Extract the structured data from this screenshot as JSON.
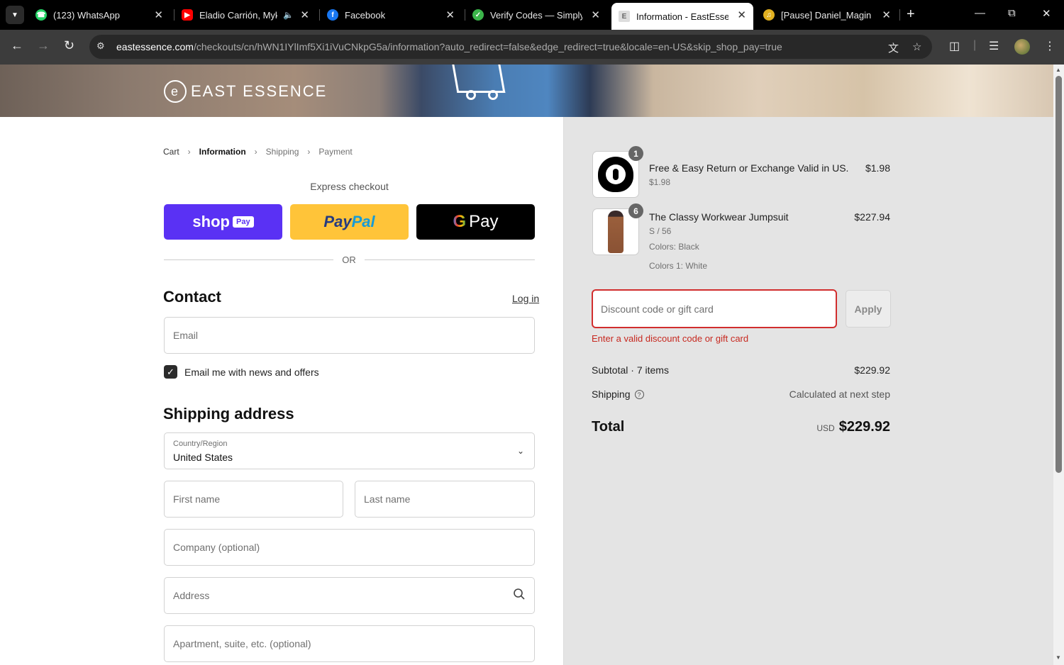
{
  "browser": {
    "tabs": [
      {
        "title": "(123) WhatsApp",
        "icon": "whatsapp-icon",
        "color": "#25d366"
      },
      {
        "title": "Eladio Carrión, Myk",
        "icon": "youtube-icon",
        "color": "#ff0000"
      },
      {
        "title": "Facebook",
        "icon": "facebook-icon",
        "color": "#1877f2"
      },
      {
        "title": "Verify Codes — SimplyC",
        "icon": "simplycodes-icon",
        "color": "#3bb54a"
      },
      {
        "title": "Information - EastEssen",
        "icon": "eastessence-icon",
        "color": "#888888"
      },
      {
        "title": "[Pause] Daniel_Magin",
        "icon": "music-icon",
        "color": "#e0b020"
      }
    ],
    "url_domain": "eastessence.com",
    "url_path": "/checkouts/cn/hWN1IYlImf5Xi1iVuCNkpG5a/information?auto_redirect=false&edge_redirect=true&locale=en-US&skip_shop_pay=true"
  },
  "store": {
    "name": "EAST ESSENCE"
  },
  "breadcrumbs": [
    "Cart",
    "Information",
    "Shipping",
    "Payment"
  ],
  "express": {
    "label": "Express checkout",
    "shop": "shop",
    "shop_tag": "Pay",
    "paypal_1": "Pay",
    "paypal_2": "Pal",
    "gpay_g": "G",
    "gpay": "Pay",
    "or": "OR"
  },
  "contact": {
    "heading": "Contact",
    "login": "Log in",
    "email_placeholder": "Email",
    "newsletter_label": "Email me with news and offers",
    "newsletter_checked": true
  },
  "shipping": {
    "heading": "Shipping address",
    "country_label": "Country/Region",
    "country_value": "United States",
    "first_name": "First name",
    "last_name": "Last name",
    "company": "Company (optional)",
    "address": "Address",
    "apartment": "Apartment, suite, etc. (optional)"
  },
  "order": {
    "items": [
      {
        "qty": "1",
        "name": "Free & Easy Return or Exchange Valid in US.",
        "sub": "$1.98",
        "price": "$1.98"
      },
      {
        "qty": "6",
        "name": "The Classy Workwear Jumpsuit",
        "variant": "S / 56",
        "color1": "Colors: Black",
        "color2": "Colors 1: White",
        "price": "$227.94"
      }
    ],
    "discount_placeholder": "Discount code or gift card",
    "apply": "Apply",
    "error": "Enter a valid discount code or gift card",
    "subtotal_label": "Subtotal · 7 items",
    "subtotal": "$229.92",
    "shipping_label": "Shipping",
    "shipping_value": "Calculated at next step",
    "total_label": "Total",
    "currency": "USD",
    "total": "$229.92"
  }
}
